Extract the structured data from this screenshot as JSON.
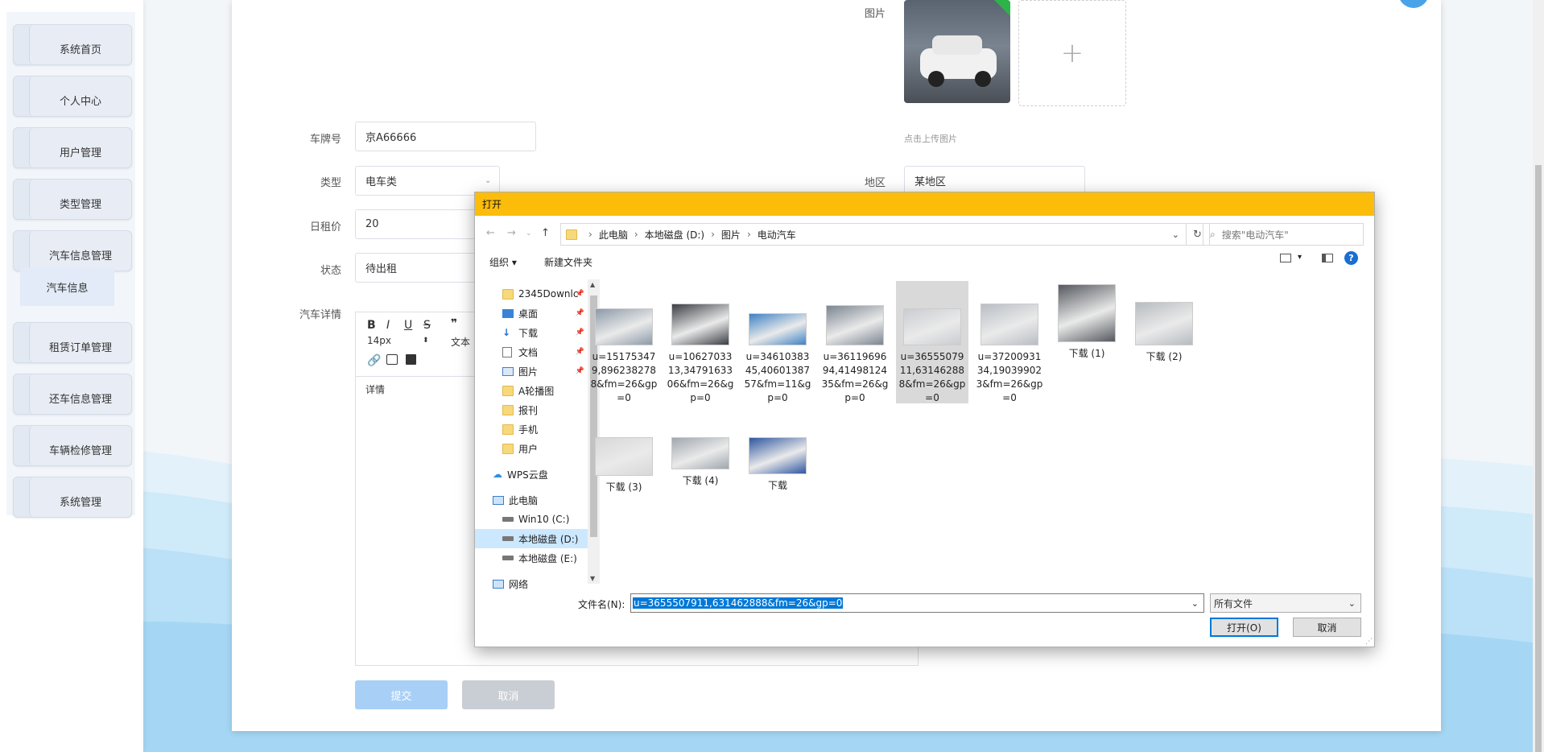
{
  "sidebar": {
    "items": [
      {
        "label": "系统首页"
      },
      {
        "label": "个人中心"
      },
      {
        "label": "用户管理"
      },
      {
        "label": "类型管理"
      },
      {
        "label": "汽车信息管理"
      },
      {
        "label": "租赁订单管理"
      },
      {
        "label": "还车信息管理"
      },
      {
        "label": "车辆检修管理"
      },
      {
        "label": "系统管理"
      }
    ],
    "submenu_label": "汽车信息"
  },
  "form": {
    "image_label": "图片",
    "upload_plus": "+",
    "upload_hint": "点击上传图片",
    "plate_label": "车牌号",
    "plate_value": "京A66666",
    "type_label": "类型",
    "type_value": "电车类",
    "area_label": "地区",
    "area_value": "某地区",
    "price_label": "日租价",
    "price_value": "20",
    "status_label": "状态",
    "status_value": "待出租",
    "detail_label": "汽车详情",
    "font_size": "14px",
    "text_style": "文本",
    "editor_content": "详情",
    "submit_label": "提交",
    "cancel_label": "取消"
  },
  "dialog": {
    "title": "打开",
    "breadcrumb": [
      "此电脑",
      "本地磁盘 (D:)",
      "图片",
      "电动汽车"
    ],
    "search_placeholder": "搜索\"电动汽车\"",
    "organize_label": "组织 ▾",
    "new_folder_label": "新建文件夹",
    "nav_items": [
      {
        "label": "2345Downlc",
        "type": "folder",
        "pinned": true
      },
      {
        "label": "桌面",
        "type": "desktop",
        "pinned": true
      },
      {
        "label": "下载",
        "type": "download",
        "pinned": true
      },
      {
        "label": "文档",
        "type": "docs",
        "pinned": true
      },
      {
        "label": "图片",
        "type": "pictures",
        "pinned": true
      },
      {
        "label": "A轮播图",
        "type": "folder"
      },
      {
        "label": "报刊",
        "type": "folder"
      },
      {
        "label": "手机",
        "type": "folder"
      },
      {
        "label": "用户",
        "type": "folder"
      },
      {
        "label": "WPS云盘",
        "type": "cloud"
      },
      {
        "label": "此电脑",
        "type": "pc"
      },
      {
        "label": "Win10 (C:)",
        "type": "drive"
      },
      {
        "label": "本地磁盘 (D:)",
        "type": "drive",
        "selected": true
      },
      {
        "label": "本地磁盘 (E:)",
        "type": "drive"
      },
      {
        "label": "网络",
        "type": "network"
      }
    ],
    "files": [
      {
        "name": "u=151753479,8962382788&fm=26&gp=0",
        "color": "#8c9aa8"
      },
      {
        "name": "u=1062703313,3479163306&fm=26&gp=0",
        "color": "#3a3d44"
      },
      {
        "name": "u=3461038345,4060138757&fm=11&gp=0",
        "color": "#3e82c4"
      },
      {
        "name": "u=3611969694,4149812435&fm=26&gp=0",
        "color": "#7b8591"
      },
      {
        "name": "u=3655507911,631462888&fm=26&gp=0",
        "color": "#c9ccd1",
        "selected": true
      },
      {
        "name": "u=3720093134,190399023&fm=26&gp=0",
        "color": "#b9bec5"
      },
      {
        "name": "下载 (1)",
        "color": "#55595f"
      },
      {
        "name": "下载 (2)",
        "color": "#b7bcc0"
      },
      {
        "name": "下载 (3)",
        "color": "#d8d8d8"
      },
      {
        "name": "下载 (4)",
        "color": "#9fa7ae"
      },
      {
        "name": "下载",
        "color": "#2f56a0"
      }
    ],
    "filename_label": "文件名(N):",
    "filename_value": "u=3655507911,631462888&fm=26&gp=0",
    "filetype_value": "所有文件",
    "open_label": "打开(O)",
    "cancel_label": "取消"
  }
}
